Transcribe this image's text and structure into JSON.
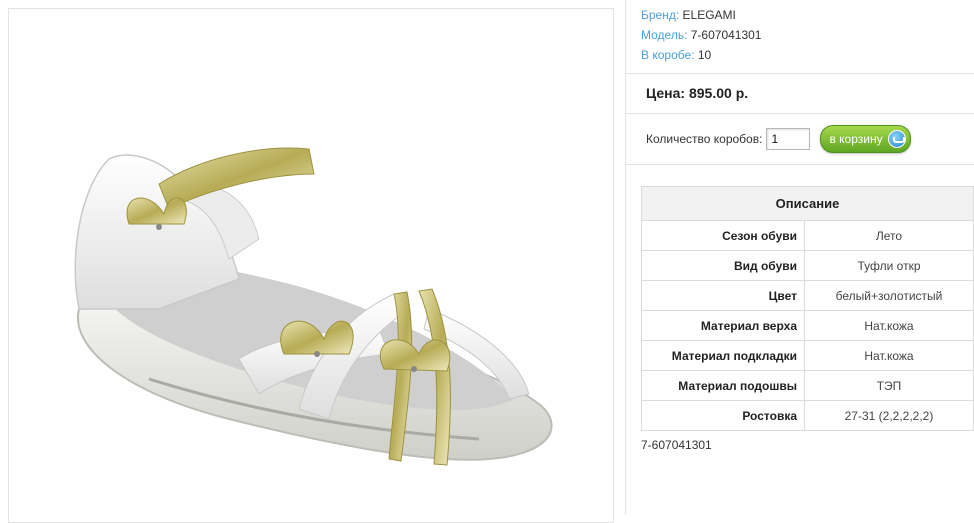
{
  "product": {
    "brand_label": "Бренд:",
    "brand": "ELEGAMI",
    "model_label": "Модель:",
    "model": "7-607041301",
    "box_label": "В коробе:",
    "box_count": "10"
  },
  "price": {
    "text": "Цена: 895.00 р."
  },
  "order": {
    "qty_label": "Количество коробов:",
    "qty_value": "1",
    "cart_label": "в корзину",
    "button_color": "#6cb52e"
  },
  "specs": {
    "header": "Описание",
    "rows": [
      {
        "label": "Сезон обуви",
        "value": "Лето"
      },
      {
        "label": "Вид обуви",
        "value": "Туфли откр"
      },
      {
        "label": "Цвет",
        "value": "белый+золотистый"
      },
      {
        "label": "Материал верха",
        "value": "Нат.кожа"
      },
      {
        "label": "Материал подкладки",
        "value": "Нат.кожа"
      },
      {
        "label": "Материал подошвы",
        "value": "ТЭП"
      },
      {
        "label": "Ростовка",
        "value": "27-31 (2,2,2,2,2)"
      }
    ]
  },
  "footer": {
    "code": "7-607041301"
  },
  "colors": {
    "link_blue": "#4a9fd8",
    "gold": "#c9be6a"
  }
}
